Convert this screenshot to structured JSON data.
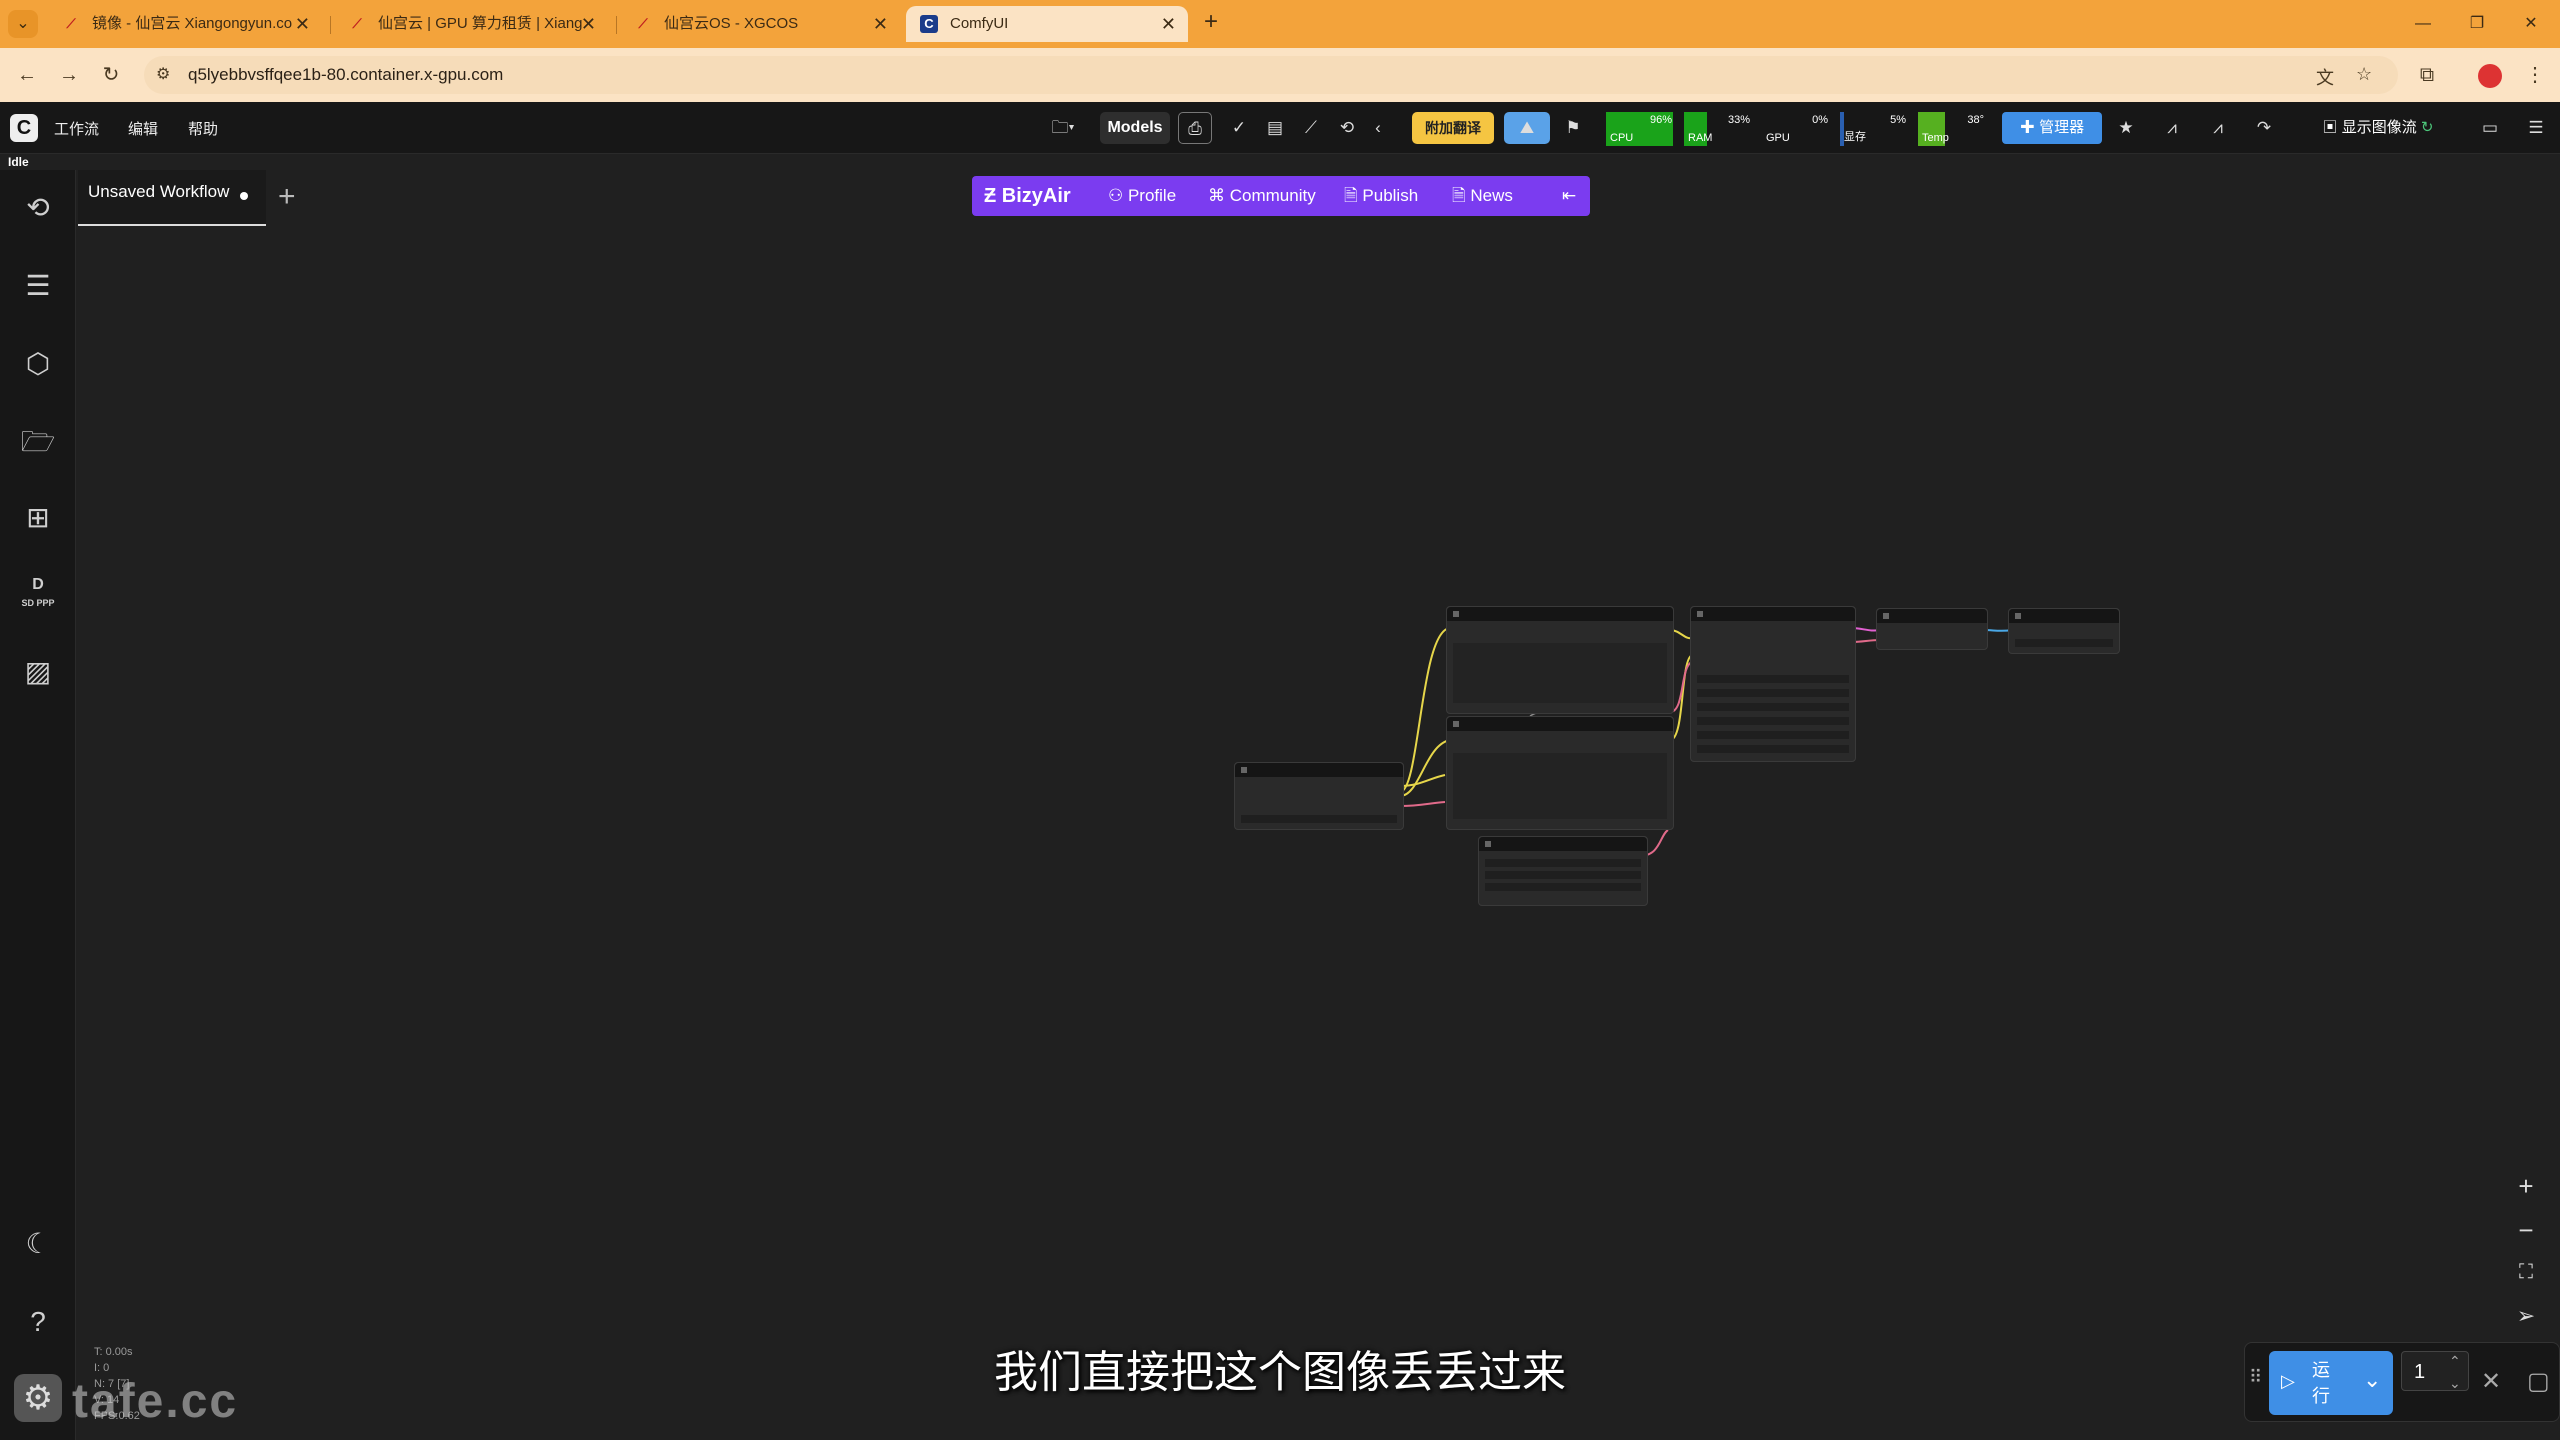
{
  "browser": {
    "tabs": [
      {
        "title": "镜像 - 仙宫云 Xiangongyun.co",
        "active": false
      },
      {
        "title": "仙宫云 | GPU 算力租赁 | Xiang",
        "active": false
      },
      {
        "title": "仙宫云OS - XGCOS",
        "active": false
      },
      {
        "title": "ComfyUI",
        "active": true
      }
    ],
    "url": "q5lyebbvsffqee1b-80.container.x-gpu.com",
    "new_tab": "+",
    "window_controls": [
      "—",
      "❐",
      "✕"
    ]
  },
  "comfy": {
    "menu": [
      "工作流",
      "编辑",
      "帮助"
    ],
    "status": "Idle",
    "toolbar": {
      "models_label": "Models",
      "translate_label": "附加翻译",
      "manager_label": "管理器",
      "show_image_label": "显示图像流"
    },
    "monitor": {
      "cpu": {
        "label": "CPU",
        "value": "96%",
        "fill": 0.96,
        "color": "#1aa31a"
      },
      "ram": {
        "label": "RAM",
        "value": "33%",
        "fill": 0.33,
        "color": "#1aa31a"
      },
      "gpu": {
        "label": "GPU",
        "value": "0%",
        "fill": 0.0,
        "color": "#1aa31a"
      },
      "vram": {
        "label": "显存",
        "value": "5%",
        "fill": 0.05,
        "color": "#2a5fb0"
      },
      "temp": {
        "label": "Temp",
        "value": "38°",
        "fill": 0.38,
        "color": "#56b020"
      }
    },
    "workflow_tab": {
      "title": "Unsaved Workflow",
      "add": "+"
    },
    "bizyair": {
      "logo": "BizyAir",
      "items": [
        "Profile",
        "Community",
        "Publish",
        "News"
      ]
    },
    "sidebar_icons": [
      "history-icon",
      "queue-icon",
      "model-library-icon",
      "workflows-icon",
      "node-library-icon",
      "sdppp-icon",
      "image-feed-icon",
      "theme-icon",
      "help-icon",
      "settings-icon"
    ],
    "sidebar_sdppp_label": "SD PPP",
    "stats": [
      "T: 0.00s",
      "I: 0",
      "N: 7 [7]",
      "V: 14",
      "FPS:0.62"
    ],
    "run": {
      "label": "运行",
      "count": "1"
    },
    "subtitle": "我们直接把这个图像丢丢过来",
    "watermark": "tafe.cc"
  }
}
